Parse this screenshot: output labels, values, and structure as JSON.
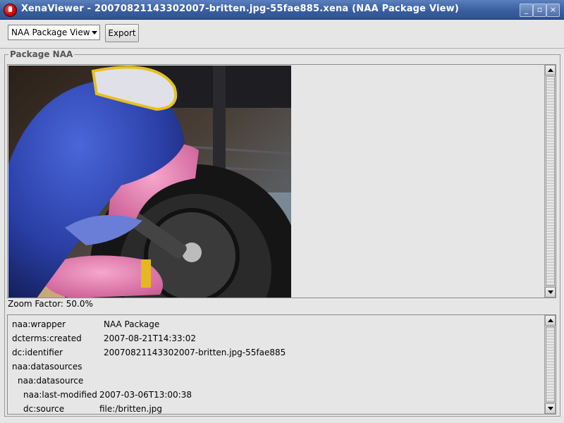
{
  "window": {
    "title": "XenaViewer - 20070821143302007-britten.jpg-55fae885.xena (NAA Package View)",
    "minimize": "_",
    "maximize": "▫",
    "close": "×"
  },
  "toolbar": {
    "view_select": "NAA Package View",
    "export_label": "Export"
  },
  "package": {
    "group_title": "Package NAA",
    "zoom_label": "Zoom Factor: 50.0%"
  },
  "metadata": [
    {
      "key": "naa:wrapper",
      "value": "NAA Package"
    },
    {
      "key": "dcterms:created",
      "value": "2007-08-21T14:33:02"
    },
    {
      "key": "dc:identifier",
      "value": "20070821143302007-britten.jpg-55fae885"
    },
    {
      "key": "naa:datasources",
      "value": ""
    },
    {
      "key": "naa:datasource",
      "value": ""
    },
    {
      "key": "naa:last-modified",
      "value": "2007-03-06T13:00:38"
    },
    {
      "key": "dc:source",
      "value": "file:/britten.jpg"
    }
  ],
  "colors": {
    "titlebar": "#3a5f9f",
    "motorcycle_blue": "#2a3fa6",
    "motorcycle_pink": "#e985b4"
  },
  "icons": [
    "app-icon",
    "minimize-icon",
    "maximize-icon",
    "close-icon",
    "dropdown-arrow-icon",
    "scroll-up-icon",
    "scroll-down-icon"
  ]
}
